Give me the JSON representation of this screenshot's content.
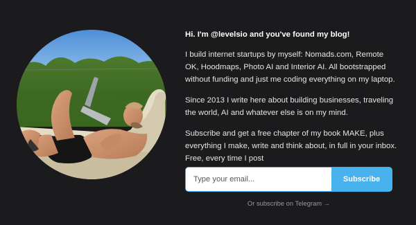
{
  "intro": {
    "headline": "Hi. I'm @levelsio and you've found my blog!",
    "paragraphs": [
      "I build internet startups by myself: Nomads.com, Remote OK, Hoodmaps, Photo AI and Interior AI. All bootstrapped without funding and just me coding everything on my laptop.",
      "Since 2013 I write here about building businesses, traveling the world, AI and whatever else is on my mind.",
      "Subscribe and get a free chapter of my book MAKE, plus everything I make, write and think about, in full in your inbox. Free, every time I post"
    ]
  },
  "subscribe": {
    "email_placeholder": "Type your email...",
    "button_label": "Subscribe",
    "telegram_link": "Or subscribe on Telegram →"
  },
  "colors": {
    "background": "#1b1b1d",
    "accent": "#47b2ee"
  }
}
